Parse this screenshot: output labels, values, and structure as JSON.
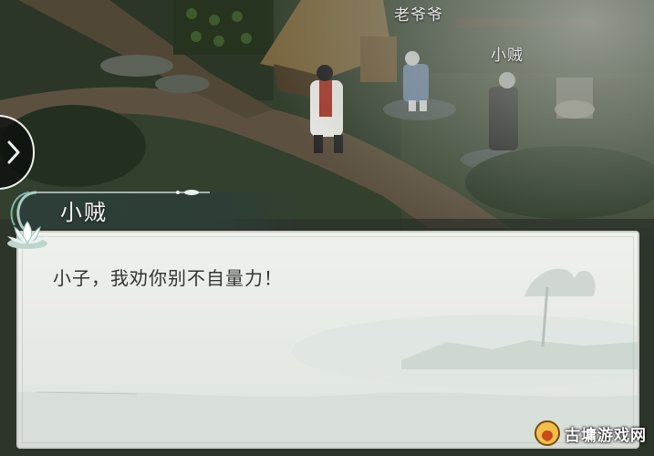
{
  "npc_labels": {
    "grandpa": "老爷爷",
    "thief": "小贼"
  },
  "dialog": {
    "speaker": "小贼",
    "text": "小子，我劝你别不自量力！"
  },
  "watermark": {
    "text": "古墉游戏网"
  },
  "icons": {
    "nav": "chevron-right-icon",
    "lotus": "lotus-icon",
    "watermark_logo": "watermark-logo-icon"
  },
  "colors": {
    "dialog_bg": "#f1f4ef",
    "banner": "#2a3a34",
    "accent_teal": "#7fb3a6"
  }
}
